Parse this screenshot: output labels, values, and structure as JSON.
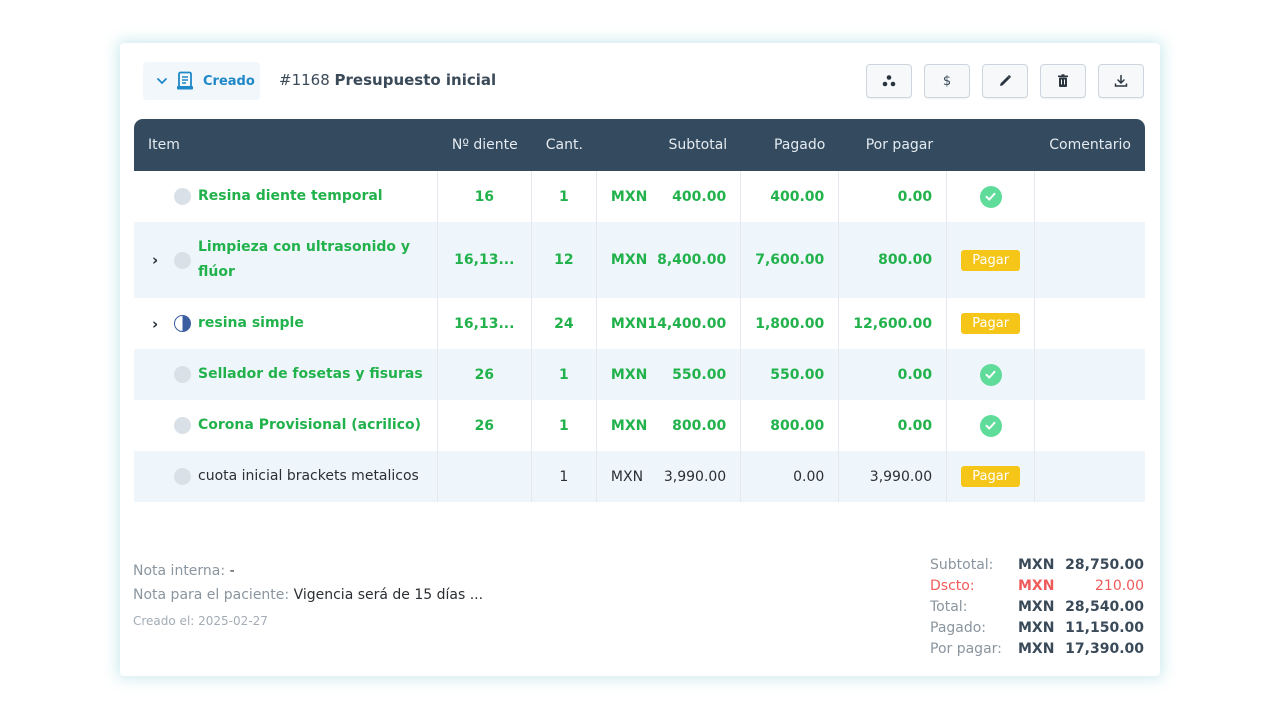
{
  "header": {
    "status_label": "Creado",
    "budget_number": "#1168",
    "budget_name": "Presupuesto inicial",
    "actions": [
      {
        "icon": "share-nodes-icon"
      },
      {
        "icon": "dollar-icon",
        "label": "$"
      },
      {
        "icon": "pencil-icon"
      },
      {
        "icon": "trash-icon"
      },
      {
        "icon": "download-icon"
      }
    ]
  },
  "table": {
    "columns": [
      "Item",
      "Nº diente",
      "Cant.",
      "Subtotal",
      "Pagado",
      "Por pagar",
      "Comentario"
    ],
    "rows": [
      {
        "item": "Resina diente temporal",
        "tooth": "16",
        "qty": "1",
        "currency": "MXN",
        "subtotal": "400.00",
        "paid": "400.00",
        "due": "0.00",
        "action": "check"
      },
      {
        "item": "Limpieza con ultrasonido y flúor",
        "tooth": "16,13...",
        "qty": "12",
        "currency": "MXN",
        "subtotal": "8,400.00",
        "paid": "7,600.00",
        "due": "800.00",
        "action": "Pagar"
      },
      {
        "item": "resina simple",
        "tooth": "16,13...",
        "qty": "24",
        "currency": "MXN",
        "subtotal": "14,400.00",
        "paid": "1,800.00",
        "due": "12,600.00",
        "action": "Pagar"
      },
      {
        "item": "Sellador de fosetas y fisuras",
        "tooth": "26",
        "qty": "1",
        "currency": "MXN",
        "subtotal": "550.00",
        "paid": "550.00",
        "due": "0.00",
        "action": "check"
      },
      {
        "item": "Corona Provisional (acrilico)",
        "tooth": "26",
        "qty": "1",
        "currency": "MXN",
        "subtotal": "800.00",
        "paid": "800.00",
        "due": "0.00",
        "action": "check"
      },
      {
        "item": "cuota inicial brackets metalicos",
        "tooth": "",
        "qty": "1",
        "currency": "MXN",
        "subtotal": "3,990.00",
        "paid": "0.00",
        "due": "3,990.00",
        "action": "Pagar"
      }
    ]
  },
  "notes": {
    "internal_label": "Nota interna:",
    "internal_value": "-",
    "patient_label": "Nota para el paciente:",
    "patient_value": "Vigencia será de 15 días ...",
    "created": "Creado el: 2025-02-27"
  },
  "totals": {
    "subtotal": {
      "label": "Subtotal:",
      "currency": "MXN",
      "amount": "28,750.00"
    },
    "discount": {
      "label": "Dscto:",
      "currency": "MXN",
      "amount": "210.00"
    },
    "total": {
      "label": "Total:",
      "currency": "MXN",
      "amount": "28,540.00"
    },
    "paid": {
      "label": "Pagado:",
      "currency": "MXN",
      "amount": "11,150.00"
    },
    "due": {
      "label": "Por pagar:",
      "currency": "MXN",
      "amount": "17,390.00"
    }
  },
  "colors": {
    "header_bg": "#344a5e",
    "paid_green": "#22b24c",
    "pay_button": "#f5c518",
    "discount_red": "#ef5b5b",
    "status_blue": "#1e88c8"
  }
}
